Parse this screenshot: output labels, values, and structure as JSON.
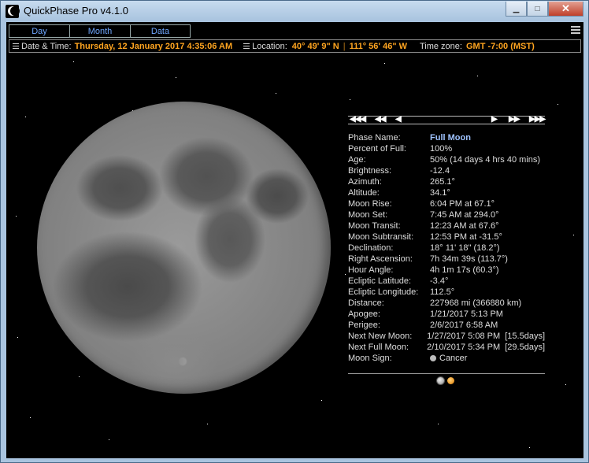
{
  "window": {
    "title": "QuickPhase Pro v4.1.0",
    "minimize": "▁",
    "maximize": "□",
    "close": "✕"
  },
  "tabs": [
    "Day",
    "Month",
    "Data"
  ],
  "infobar": {
    "datetime_label": "Date & Time:",
    "datetime_value": "Thursday, 12 January 2017 4:35:06 AM",
    "location_label": "Location:",
    "latitude": "40° 49' 9\" N",
    "longitude": "111° 56' 46\" W",
    "timezone_label": "Time zone:",
    "timezone_value": "GMT -7:00 (MST)"
  },
  "nav": {
    "back_far": "◀◀◀",
    "back_mid": "◀◀",
    "back": "◀",
    "fwd": "▶",
    "fwd_mid": "▶▶",
    "fwd_far": "▶▶▶"
  },
  "moon_data": [
    {
      "label": "Phase Name:",
      "value": "Full Moon"
    },
    {
      "label": "Percent of Full:",
      "value": "100%"
    },
    {
      "label": "Age:",
      "value": "50% (14 days 4 hrs 40 mins)"
    },
    {
      "label": "Brightness:",
      "value": "-12.4"
    },
    {
      "label": "Azimuth:",
      "value": "265.1°"
    },
    {
      "label": "Altitude:",
      "value": "34.1°"
    },
    {
      "label": "Moon Rise:",
      "value": "6:04 PM at 67.1°"
    },
    {
      "label": "Moon Set:",
      "value": "7:45 AM at 294.0°"
    },
    {
      "label": "Moon Transit:",
      "value": "12:23 AM at 67.6°"
    },
    {
      "label": "Moon Subtransit:",
      "value": "12:53 PM at -31.5°"
    },
    {
      "label": "Declination:",
      "value": "18° 11' 18\" (18.2°)"
    },
    {
      "label": "Right Ascension:",
      "value": "7h 34m 39s (113.7°)"
    },
    {
      "label": "Hour Angle:",
      "value": "4h 1m 17s (60.3°)"
    },
    {
      "label": "Ecliptic Latitude:",
      "value": "-3.4°"
    },
    {
      "label": "Ecliptic Longitude:",
      "value": "112.5°"
    },
    {
      "label": "Distance:",
      "value": "227968 mi (366880 km)"
    },
    {
      "label": "Apogee:",
      "value": "1/21/2017 5:13 PM"
    },
    {
      "label": "Perigee:",
      "value": "2/6/2017 6:58 AM"
    },
    {
      "label": "Next New Moon:",
      "value": "1/27/2017 5:08 PM  [15.5days]"
    },
    {
      "label": "Next Full Moon:",
      "value": "2/10/2017 5:34 PM  [29.5days]"
    },
    {
      "label": "Moon Sign:",
      "value": "Cancer",
      "icon": "cancer-sign-icon"
    }
  ]
}
